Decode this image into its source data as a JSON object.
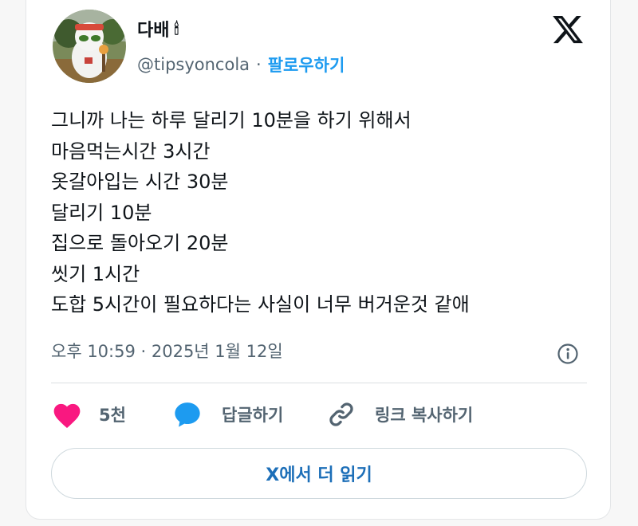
{
  "author": {
    "name": "다배",
    "name_emoji": "🕯",
    "handle": "@tipsyoncola",
    "separator": "·",
    "follow_label": "팔로우하기"
  },
  "tweet": {
    "text": "그니까 나는 하루 달리기 10분을 하기 위해서\n마음먹는시간 3시간\n옷갈아입는 시간 30분\n달리기 10분\n집으로 돌아오기 20분\n씻기 1시간\n도합 5시간이 필요하다는 사실이 너무 버거운것 같애",
    "timestamp": "오후 10:59 · 2025년 1월 12일"
  },
  "actions": {
    "like_count": "5천",
    "reply_label": "답글하기",
    "copy_link_label": "링크 복사하기"
  },
  "read_more_label": "X에서 더 읽기",
  "colors": {
    "like": "#f91880",
    "reply": "#1d9bf0",
    "follow": "#1d9bf0",
    "read_more": "#1d6fb8",
    "muted": "#536471"
  },
  "icons": [
    "x-logo-icon",
    "info-icon",
    "heart-icon",
    "speech-bubble-icon",
    "link-icon"
  ]
}
